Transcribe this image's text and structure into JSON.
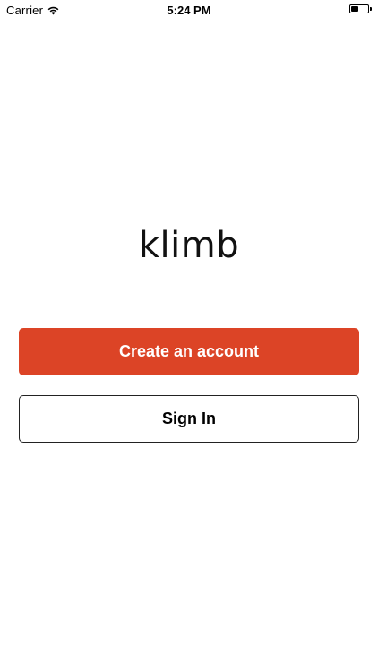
{
  "status_bar": {
    "carrier": "Carrier",
    "time": "5:24 PM",
    "battery_level": 0.45,
    "wifi_icon": "wifi-icon",
    "battery_icon": "battery-icon"
  },
  "brand": {
    "logo_text": "klimb"
  },
  "actions": {
    "create_account_label": "Create an account",
    "sign_in_label": "Sign In"
  },
  "colors": {
    "primary": "#DC4426",
    "primary_text": "#FFFFFF",
    "outline": "#222222"
  }
}
